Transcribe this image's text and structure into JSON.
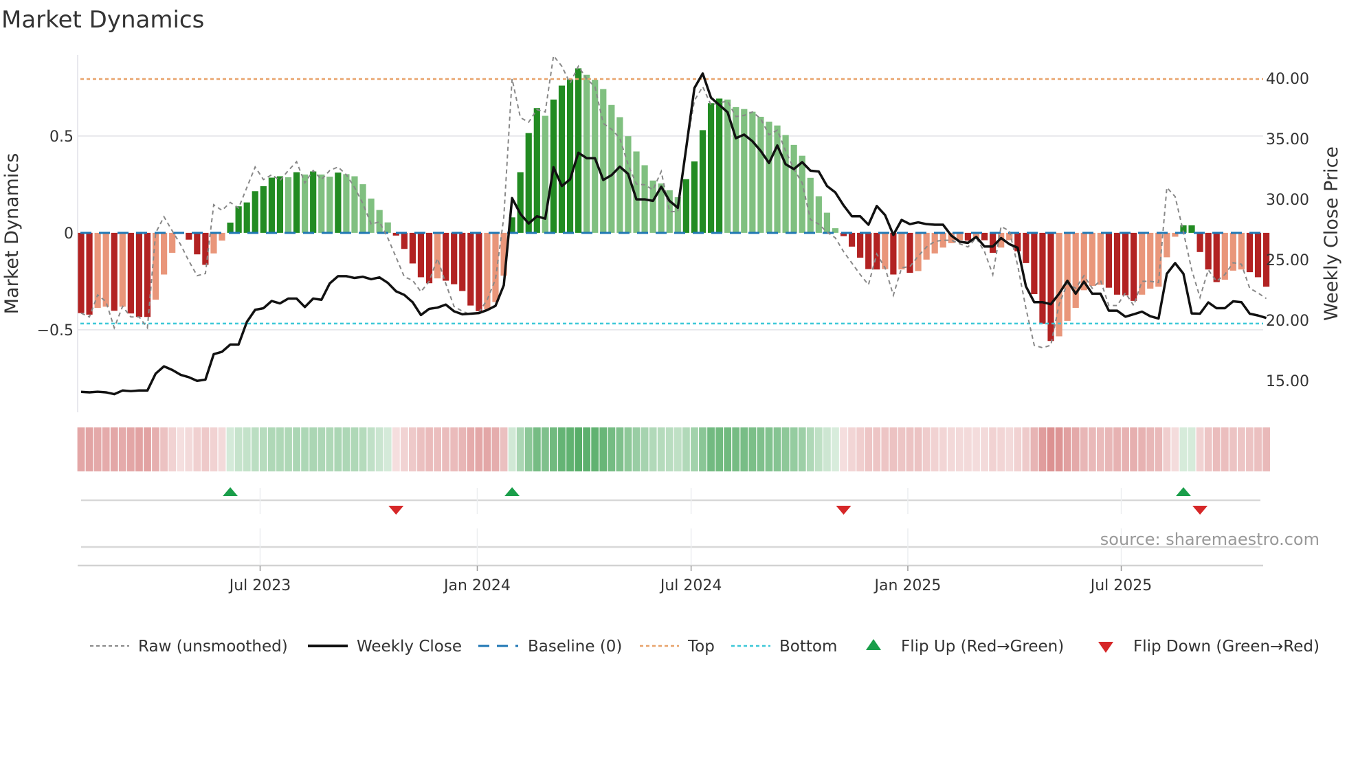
{
  "chart_data": {
    "type": "bar",
    "title": "Market Dynamics",
    "ylabel": "Market Dynamics",
    "y2label": "Weekly Close Price",
    "ylim": [
      -0.926,
      0.918
    ],
    "y2lim": [
      12.4,
      41.93
    ],
    "grid": true,
    "legend_placement": "bottom",
    "source": "source: sharemaestro.com",
    "y_ticks": [
      {
        "v": 0.5,
        "label": "0.5"
      },
      {
        "v": 0,
        "label": "0"
      },
      {
        "v": -0.5,
        "label": "−0.5"
      }
    ],
    "y2_ticks": [
      {
        "v": 40,
        "label": "40.00"
      },
      {
        "v": 35,
        "label": "35.00"
      },
      {
        "v": 30,
        "label": "30.00"
      },
      {
        "v": 25,
        "label": "25.00"
      },
      {
        "v": 20,
        "label": "20.00"
      },
      {
        "v": 15,
        "label": "15.00"
      }
    ],
    "x_ticks": [
      {
        "week": 21.6,
        "label": "Jul 2023"
      },
      {
        "week": 47.8,
        "label": "Jan 2024"
      },
      {
        "week": 73.6,
        "label": "Jul 2024"
      },
      {
        "week": 99.75,
        "label": "Jan 2025"
      },
      {
        "week": 125.5,
        "label": "Jul 2025"
      }
    ],
    "baseline": 0,
    "top": 0.794,
    "bottom": -0.468,
    "colors": {
      "strong_up": "#228b22",
      "weak_up": "#80c080",
      "strong_down": "#b22222",
      "weak_down": "#e9967a",
      "raw": "#888888",
      "close": "#111111",
      "baseline": "#1f77b4",
      "top": "#e8a36b",
      "bottom": "#3cc8d8",
      "flip_up": "#1a9e4a",
      "flip_down": "#d62728",
      "heat_up": "#3ca050",
      "heat_down": "#c85050"
    },
    "values": [
      -0.414,
      -0.422,
      -0.387,
      -0.381,
      -0.402,
      -0.381,
      -0.416,
      -0.434,
      -0.434,
      -0.345,
      -0.215,
      -0.103,
      -0.005,
      -0.035,
      -0.111,
      -0.165,
      -0.106,
      -0.04,
      0.053,
      0.137,
      0.157,
      0.215,
      0.241,
      0.285,
      0.292,
      0.287,
      0.313,
      0.301,
      0.317,
      0.301,
      0.29,
      0.311,
      0.303,
      0.292,
      0.251,
      0.177,
      0.118,
      0.054,
      -0.014,
      -0.083,
      -0.158,
      -0.229,
      -0.26,
      -0.235,
      -0.247,
      -0.265,
      -0.3,
      -0.375,
      -0.404,
      -0.395,
      -0.357,
      -0.221,
      0.08,
      0.313,
      0.515,
      0.644,
      0.604,
      0.688,
      0.76,
      0.792,
      0.849,
      0.816,
      0.79,
      0.742,
      0.66,
      0.597,
      0.499,
      0.42,
      0.349,
      0.27,
      0.255,
      0.22,
      0.184,
      0.277,
      0.369,
      0.53,
      0.669,
      0.693,
      0.688,
      0.649,
      0.639,
      0.625,
      0.599,
      0.574,
      0.554,
      0.505,
      0.454,
      0.398,
      0.284,
      0.189,
      0.104,
      0.024,
      -0.017,
      -0.071,
      -0.128,
      -0.187,
      -0.189,
      -0.187,
      -0.215,
      -0.189,
      -0.206,
      -0.197,
      -0.138,
      -0.106,
      -0.076,
      -0.053,
      -0.038,
      -0.04,
      -0.026,
      -0.038,
      -0.103,
      -0.076,
      -0.038,
      -0.095,
      -0.156,
      -0.316,
      -0.469,
      -0.558,
      -0.534,
      -0.454,
      -0.387,
      -0.296,
      -0.274,
      -0.268,
      -0.283,
      -0.319,
      -0.322,
      -0.351,
      -0.319,
      -0.288,
      -0.278,
      -0.126,
      -0.02,
      0.039,
      0.039,
      -0.099,
      -0.189,
      -0.254,
      -0.242,
      -0.195,
      -0.189,
      -0.203,
      -0.229,
      -0.278
    ],
    "strong": [
      1,
      1,
      0,
      0,
      1,
      0,
      1,
      1,
      1,
      0,
      0,
      0,
      0,
      1,
      1,
      1,
      0,
      0,
      1,
      1,
      1,
      1,
      1,
      1,
      1,
      0,
      1,
      0,
      1,
      0,
      0,
      1,
      0,
      0,
      0,
      0,
      0,
      0,
      1,
      1,
      1,
      1,
      1,
      0,
      1,
      1,
      1,
      1,
      1,
      0,
      0,
      0,
      1,
      1,
      1,
      1,
      0,
      1,
      1,
      1,
      1,
      0,
      0,
      0,
      0,
      0,
      0,
      0,
      0,
      0,
      0,
      0,
      0,
      1,
      1,
      1,
      1,
      1,
      0,
      0,
      0,
      0,
      0,
      0,
      0,
      0,
      0,
      0,
      0,
      0,
      0,
      0,
      1,
      1,
      1,
      1,
      1,
      0,
      1,
      0,
      1,
      0,
      0,
      0,
      0,
      0,
      0,
      1,
      0,
      1,
      1,
      0,
      0,
      1,
      1,
      1,
      1,
      1,
      0,
      0,
      0,
      0,
      0,
      0,
      1,
      1,
      1,
      1,
      0,
      0,
      0,
      0,
      0,
      1,
      1,
      1,
      1,
      1,
      0,
      0,
      0,
      1,
      1,
      1
    ],
    "close": [
      14.09,
      14.05,
      14.1,
      14.05,
      13.9,
      14.2,
      14.15,
      14.2,
      14.2,
      15.6,
      16.2,
      15.9,
      15.5,
      15.3,
      15.0,
      15.1,
      17.2,
      17.4,
      18.0,
      18.0,
      19.87,
      20.87,
      21.0,
      21.6,
      21.4,
      21.8,
      21.8,
      21.1,
      21.8,
      21.7,
      23.05,
      23.65,
      23.65,
      23.5,
      23.6,
      23.4,
      23.55,
      23.1,
      22.4,
      22.1,
      21.5,
      20.44,
      20.95,
      21.05,
      21.3,
      20.75,
      20.5,
      20.55,
      20.6,
      20.85,
      21.2,
      22.9,
      30.1,
      28.8,
      28.0,
      28.6,
      28.4,
      32.65,
      31.1,
      31.65,
      33.85,
      33.4,
      33.4,
      31.6,
      32.0,
      32.7,
      32.1,
      30.0,
      30.0,
      29.87,
      31.04,
      29.87,
      29.3,
      34.2,
      39.2,
      40.4,
      38.4,
      37.8,
      37.2,
      35.05,
      35.35,
      34.8,
      34.0,
      33.0,
      34.45,
      32.9,
      32.5,
      33.07,
      32.37,
      32.3,
      31.1,
      30.57,
      29.5,
      28.6,
      28.6,
      27.9,
      29.45,
      28.7,
      27.06,
      28.3,
      27.95,
      28.1,
      27.95,
      27.9,
      27.9,
      27.0,
      26.5,
      26.4,
      26.9,
      26.1,
      26.1,
      26.8,
      26.3,
      26.0,
      22.8,
      21.5,
      21.5,
      21.33,
      22.2,
      23.27,
      22.2,
      23.2,
      22.2,
      22.2,
      20.8,
      20.8,
      20.3,
      20.5,
      20.72,
      20.34,
      20.15,
      23.85,
      24.73,
      23.85,
      20.57,
      20.55,
      21.48,
      21.0,
      21.0,
      21.57,
      21.5,
      20.55,
      20.4,
      20.2
    ],
    "raw": [
      -0.414,
      -0.434,
      -0.32,
      -0.355,
      -0.49,
      -0.38,
      -0.434,
      -0.434,
      -0.49,
      0.0,
      0.083,
      0.01,
      -0.06,
      -0.145,
      -0.221,
      -0.21,
      0.145,
      0.116,
      0.157,
      0.128,
      0.234,
      0.34,
      0.275,
      0.3,
      0.27,
      0.322,
      0.367,
      0.258,
      0.322,
      0.275,
      0.322,
      0.34,
      0.3,
      0.234,
      0.151,
      0.045,
      0.057,
      -0.026,
      -0.126,
      -0.227,
      -0.245,
      -0.304,
      -0.25,
      -0.132,
      -0.262,
      -0.38,
      -0.404,
      -0.422,
      -0.41,
      -0.345,
      -0.239,
      0.08,
      0.795,
      0.595,
      0.571,
      0.636,
      0.624,
      0.914,
      0.86,
      0.772,
      0.86,
      0.795,
      0.754,
      0.565,
      0.535,
      0.488,
      0.352,
      0.252,
      0.248,
      0.222,
      0.317,
      0.11,
      0.11,
      0.435,
      0.683,
      0.754,
      0.66,
      0.671,
      0.68,
      0.6,
      0.606,
      0.624,
      0.589,
      0.506,
      0.53,
      0.423,
      0.329,
      0.258,
      0.069,
      0.045,
      0.004,
      -0.026,
      -0.097,
      -0.156,
      -0.215,
      -0.268,
      -0.109,
      -0.18,
      -0.322,
      -0.18,
      -0.174,
      -0.12,
      -0.073,
      -0.044,
      -0.038,
      -0.038,
      -0.056,
      -0.073,
      -0.026,
      -0.097,
      -0.215,
      0.033,
      0.01,
      -0.168,
      -0.39,
      -0.58,
      -0.593,
      -0.58,
      -0.369,
      -0.262,
      -0.286,
      -0.221,
      -0.286,
      -0.245,
      -0.375,
      -0.375,
      -0.31,
      -0.375,
      -0.25,
      -0.25,
      -0.256,
      0.234,
      0.187,
      0.004,
      -0.191,
      -0.333,
      -0.191,
      -0.25,
      -0.215,
      -0.154,
      -0.162,
      -0.286,
      -0.31,
      -0.339
    ],
    "flip_up_weeks": [
      19,
      53,
      134
    ],
    "flip_down_weeks": [
      39,
      93,
      136
    ],
    "legend": {
      "raw": "Raw (unsmoothed)",
      "close": "Weekly Close",
      "baseline": "Baseline (0)",
      "top": "Top",
      "bottom": "Bottom",
      "flip_up": "Flip Up (Red→Green)",
      "flip_down": "Flip Down (Green→Red)"
    }
  }
}
